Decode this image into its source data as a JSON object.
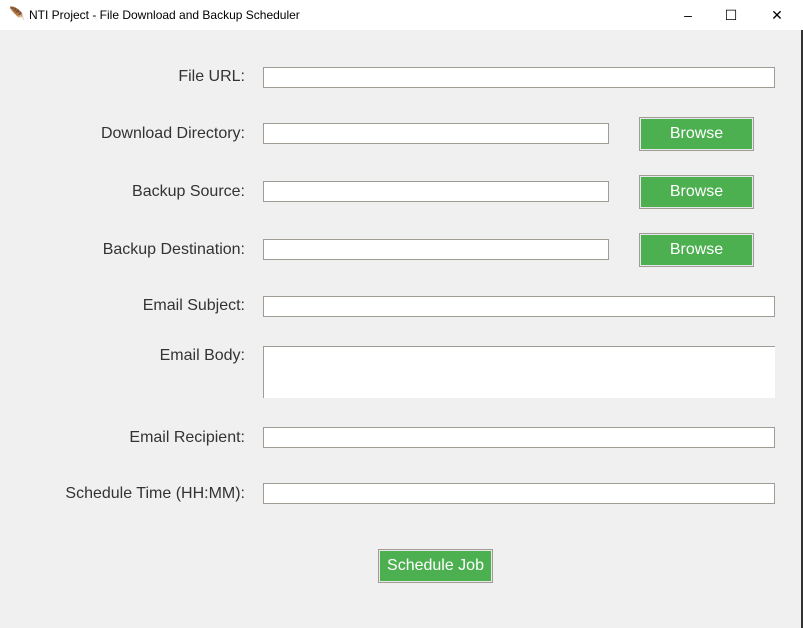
{
  "window": {
    "title": "NTI Project - File Download and Backup Scheduler",
    "minimize": "–",
    "maximize": "☐",
    "close": "✕",
    "icon": "feather-icon"
  },
  "form": {
    "file_url": {
      "label": "File URL:",
      "value": ""
    },
    "download_directory": {
      "label": "Download Directory:",
      "value": "",
      "browse": "Browse"
    },
    "backup_source": {
      "label": "Backup Source:",
      "value": "",
      "browse": "Browse"
    },
    "backup_destination": {
      "label": "Backup Destination:",
      "value": "",
      "browse": "Browse"
    },
    "email_subject": {
      "label": "Email Subject:",
      "value": ""
    },
    "email_body": {
      "label": "Email Body:",
      "value": ""
    },
    "email_recipient": {
      "label": "Email Recipient:",
      "value": ""
    },
    "schedule_time": {
      "label": "Schedule Time (HH:MM):",
      "value": ""
    },
    "submit": "Schedule Job"
  },
  "colors": {
    "button": "#4caf50",
    "background": "#f0f0f0"
  }
}
